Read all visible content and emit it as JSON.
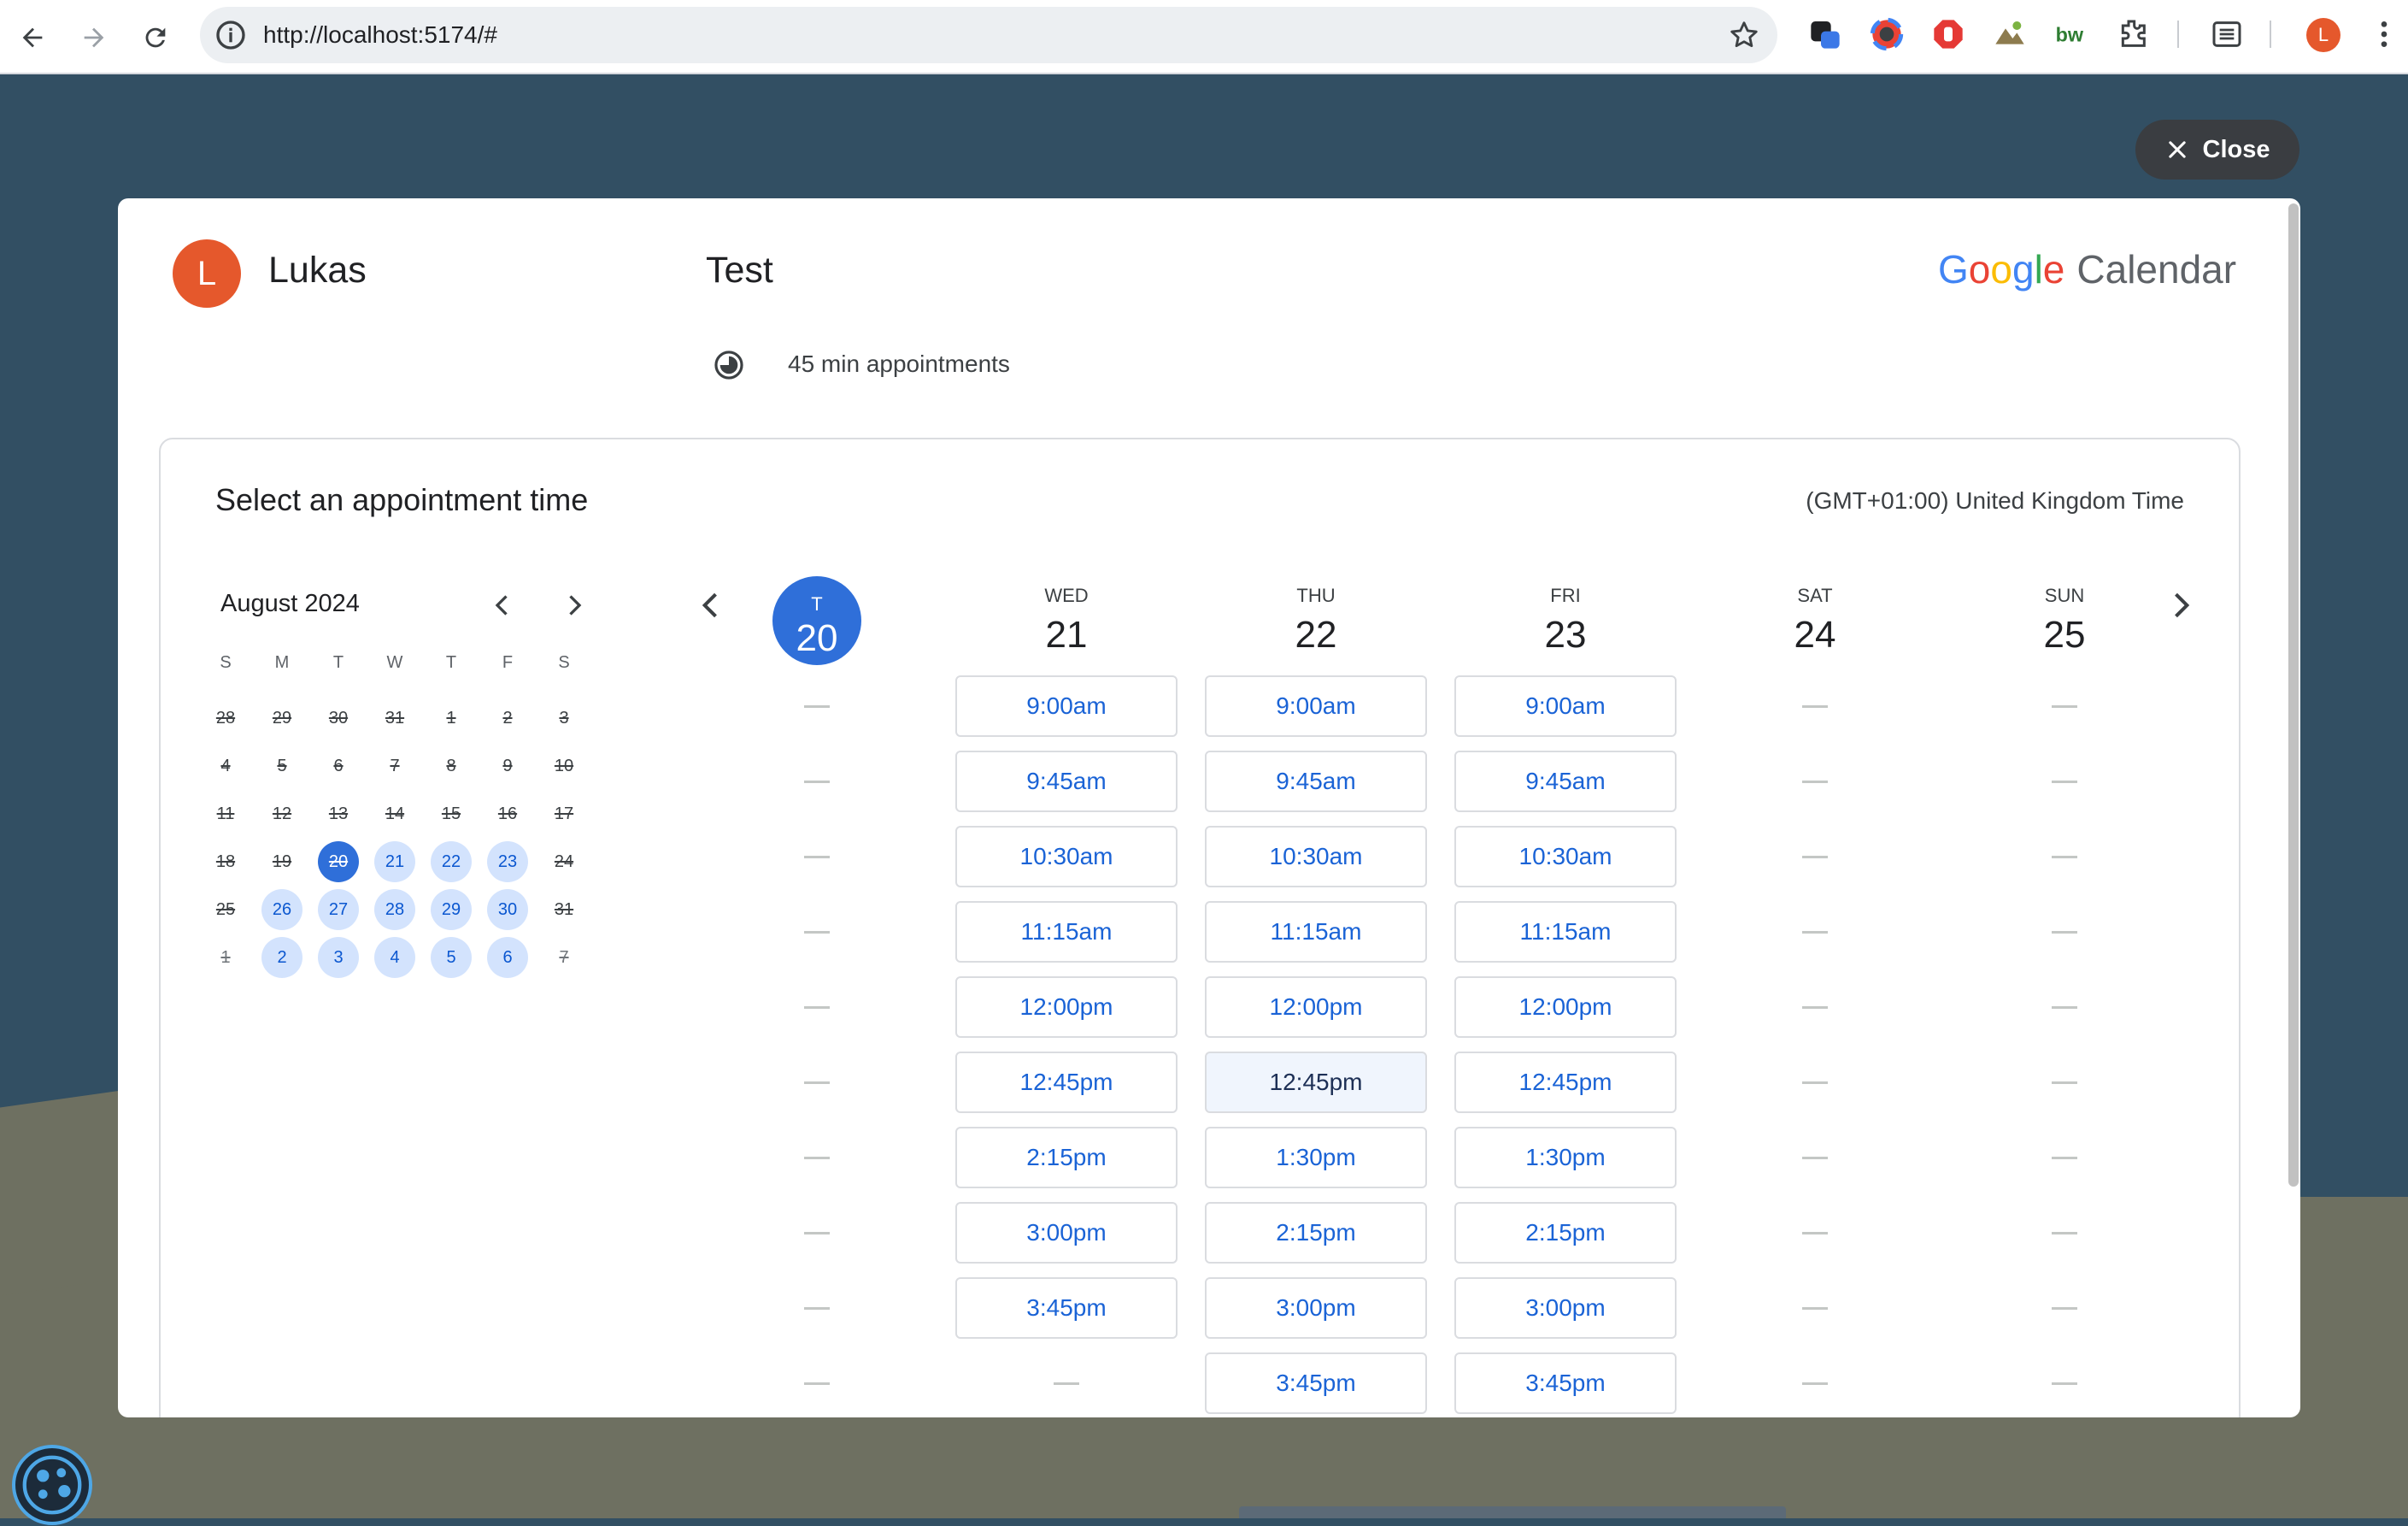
{
  "browser": {
    "url": "http://localhost:5174/#",
    "profile_initial": "L"
  },
  "overlay": {
    "close_label": "Close"
  },
  "host": {
    "initial": "L",
    "name": "Lukas"
  },
  "event": {
    "title": "Test",
    "duration": "45 min appointments"
  },
  "brand": {
    "letters": [
      {
        "ch": "G",
        "color": "#4285F4"
      },
      {
        "ch": "o",
        "color": "#EA4335"
      },
      {
        "ch": "o",
        "color": "#FBBC05"
      },
      {
        "ch": "g",
        "color": "#4285F4"
      },
      {
        "ch": "l",
        "color": "#34A853"
      },
      {
        "ch": "e",
        "color": "#EA4335"
      }
    ],
    "product": "Calendar"
  },
  "booking": {
    "heading": "Select an appointment time",
    "timezone": "(GMT+01:00) United Kingdom Time"
  },
  "mini_calendar": {
    "month_label": "August 2024",
    "weekdays": [
      "S",
      "M",
      "T",
      "W",
      "T",
      "F",
      "S"
    ],
    "weeks": [
      [
        {
          "d": "28",
          "s": "past"
        },
        {
          "d": "29",
          "s": "past"
        },
        {
          "d": "30",
          "s": "past"
        },
        {
          "d": "31",
          "s": "past"
        },
        {
          "d": "1",
          "s": "past"
        },
        {
          "d": "2",
          "s": "past"
        },
        {
          "d": "3",
          "s": "past"
        }
      ],
      [
        {
          "d": "4",
          "s": "past"
        },
        {
          "d": "5",
          "s": "past"
        },
        {
          "d": "6",
          "s": "past"
        },
        {
          "d": "7",
          "s": "past"
        },
        {
          "d": "8",
          "s": "past"
        },
        {
          "d": "9",
          "s": "past"
        },
        {
          "d": "10",
          "s": "past"
        }
      ],
      [
        {
          "d": "11",
          "s": "past"
        },
        {
          "d": "12",
          "s": "past"
        },
        {
          "d": "13",
          "s": "past"
        },
        {
          "d": "14",
          "s": "past"
        },
        {
          "d": "15",
          "s": "past"
        },
        {
          "d": "16",
          "s": "past"
        },
        {
          "d": "17",
          "s": "past"
        }
      ],
      [
        {
          "d": "18",
          "s": "past"
        },
        {
          "d": "19",
          "s": "past"
        },
        {
          "d": "20",
          "s": "today"
        },
        {
          "d": "21",
          "s": "avail"
        },
        {
          "d": "22",
          "s": "avail"
        },
        {
          "d": "23",
          "s": "avail"
        },
        {
          "d": "24",
          "s": "past"
        }
      ],
      [
        {
          "d": "25",
          "s": "past"
        },
        {
          "d": "26",
          "s": "avail"
        },
        {
          "d": "27",
          "s": "avail"
        },
        {
          "d": "28",
          "s": "avail"
        },
        {
          "d": "29",
          "s": "avail"
        },
        {
          "d": "30",
          "s": "avail"
        },
        {
          "d": "31",
          "s": "past"
        }
      ],
      [
        {
          "d": "1",
          "s": "pastdim"
        },
        {
          "d": "2",
          "s": "avail"
        },
        {
          "d": "3",
          "s": "avail"
        },
        {
          "d": "4",
          "s": "avail"
        },
        {
          "d": "5",
          "s": "avail"
        },
        {
          "d": "6",
          "s": "avail"
        },
        {
          "d": "7",
          "s": "pastdim"
        }
      ]
    ]
  },
  "week": {
    "days": [
      {
        "dow": "T",
        "num": "20",
        "today": true,
        "slots": []
      },
      {
        "dow": "WED",
        "num": "21",
        "today": false,
        "slots": [
          "9:00am",
          "9:45am",
          "10:30am",
          "11:15am",
          "12:00pm",
          "12:45pm",
          "2:15pm",
          "3:00pm",
          "3:45pm"
        ]
      },
      {
        "dow": "THU",
        "num": "22",
        "today": false,
        "slots": [
          "9:00am",
          "9:45am",
          "10:30am",
          "11:15am",
          "12:00pm",
          "12:45pm",
          "1:30pm",
          "2:15pm",
          "3:00pm",
          "3:45pm"
        ]
      },
      {
        "dow": "FRI",
        "num": "23",
        "today": false,
        "slots": [
          "9:00am",
          "9:45am",
          "10:30am",
          "11:15am",
          "12:00pm",
          "12:45pm",
          "1:30pm",
          "2:15pm",
          "3:00pm",
          "3:45pm"
        ]
      },
      {
        "dow": "SAT",
        "num": "24",
        "today": false,
        "slots": []
      },
      {
        "dow": "SUN",
        "num": "25",
        "today": false,
        "slots": []
      }
    ],
    "hovered": {
      "day": 2,
      "slot": 5
    }
  }
}
